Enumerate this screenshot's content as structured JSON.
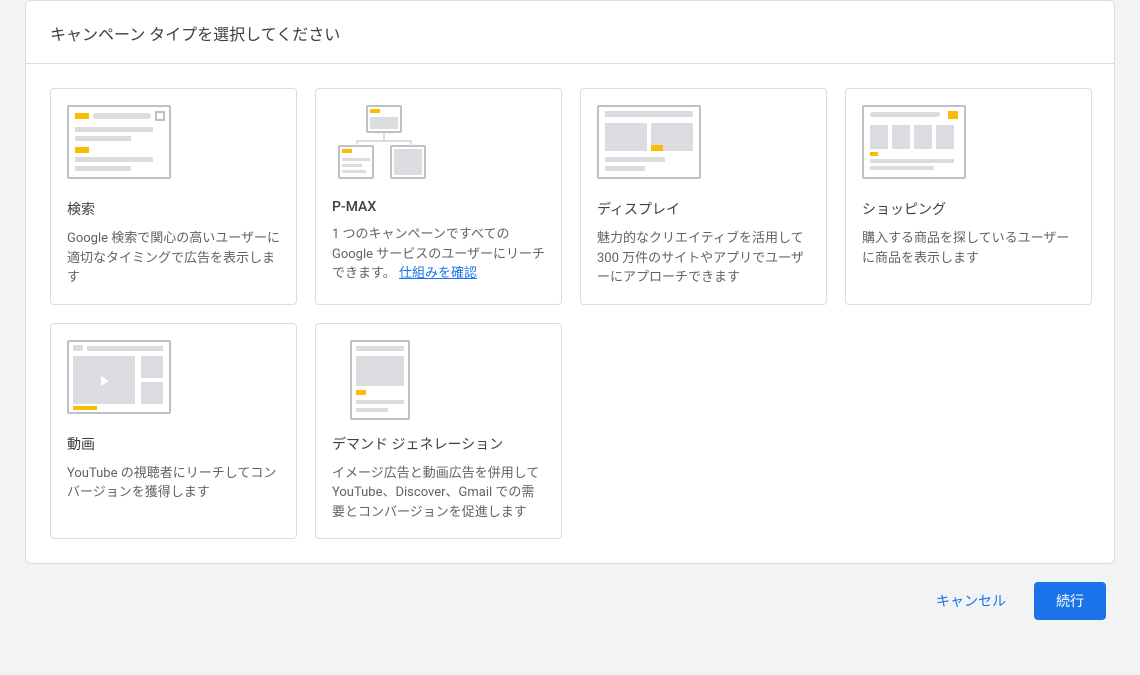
{
  "header": {
    "title": "キャンペーン タイプを選択してください"
  },
  "cards": {
    "search": {
      "title": "検索",
      "desc": "Google 検索で関心の高いユーザーに適切なタイミングで広告を表示します"
    },
    "pmax": {
      "title": "P-MAX",
      "desc_pre": "1 つのキャンペーンですべての Google サービスのユーザーにリーチできます。 ",
      "link": "仕組みを確認"
    },
    "display": {
      "title": "ディスプレイ",
      "desc": "魅力的なクリエイティブを活用して 300 万件のサイトやアプリでユーザーにアプローチできます"
    },
    "shopping": {
      "title": "ショッピング",
      "desc": "購入する商品を探しているユーザーに商品を表示します"
    },
    "video": {
      "title": "動画",
      "desc": "YouTube の視聴者にリーチしてコンバージョンを獲得します"
    },
    "demand": {
      "title": "デマンド ジェネレーション",
      "desc": "イメージ広告と動画広告を併用して YouTube、Discover、Gmail での需要とコンバージョンを促進します"
    }
  },
  "footer": {
    "cancel": "キャンセル",
    "continue": "続行"
  }
}
